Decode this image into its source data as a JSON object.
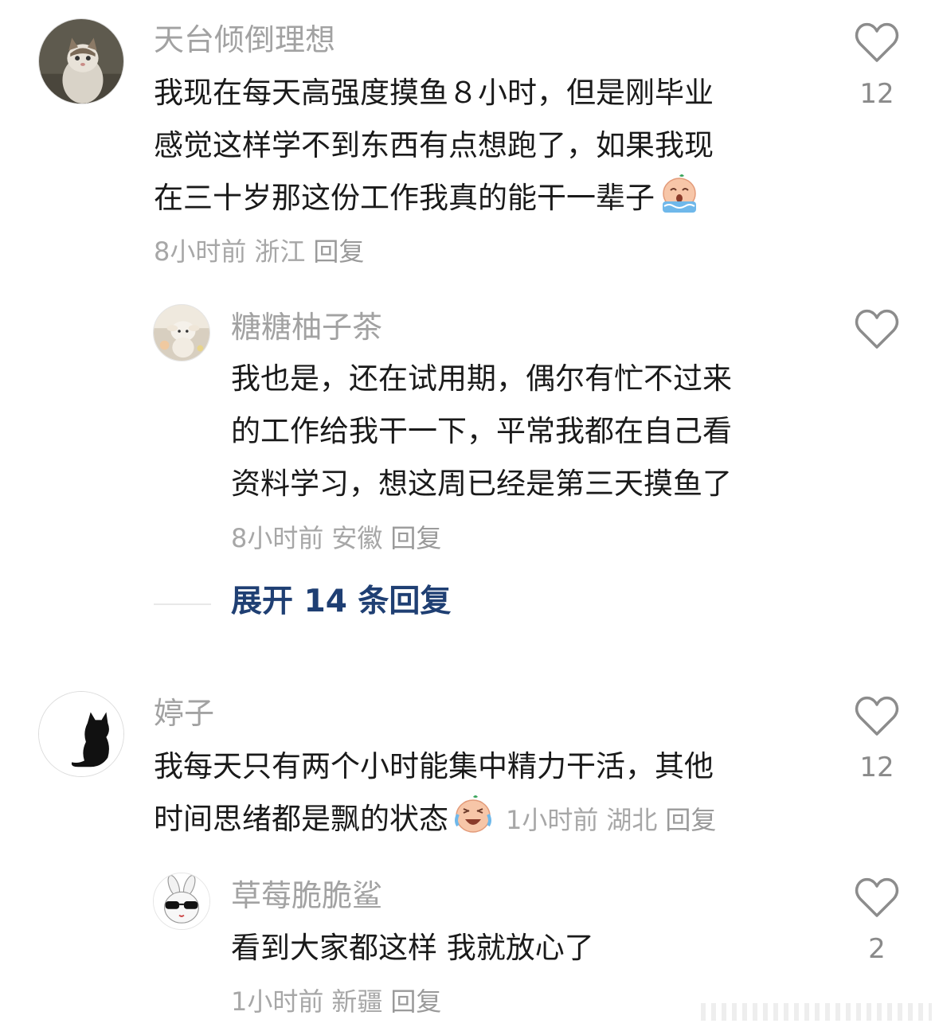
{
  "comments": [
    {
      "username": "天台倾倒理想",
      "lines": [
        "我现在每天高强度摸鱼８小时，但是刚毕业",
        "感觉这样学不到东西有点想跑了，如果我现",
        "在三十岁那这份工作我真的能干一辈子"
      ],
      "emoji": "crying-emoji",
      "time": "8小时前",
      "location": "浙江",
      "reply_label": "回复",
      "likes": "12",
      "avatar_icon": "cat-photo-avatar"
    },
    {
      "username": "糖糖柚子茶",
      "lines": [
        "我也是，还在试用期，偶尔有忙不过来",
        "的工作给我干一下，平常我都在自己看",
        "资料学习，想这周已经是第三天摸鱼了"
      ],
      "time": "8小时前",
      "location": "安徽",
      "reply_label": "回复",
      "likes": "",
      "avatar_icon": "lamb-plush-avatar"
    },
    {
      "username": "婷子",
      "lines": [
        "我每天只有两个小时能集中精力干活，其他",
        "时间思绪都是飘的状态"
      ],
      "emoji": "crying-laughing-emoji",
      "time": "1小时前",
      "location": "湖北",
      "reply_label": "回复",
      "likes": "12",
      "avatar_icon": "black-cat-silhouette-avatar"
    },
    {
      "username": "草莓脆脆鲨",
      "lines": [
        "看到大家都这样 我就放心了"
      ],
      "time": "1小时前",
      "location": "新疆",
      "reply_label": "回复",
      "likes": "2",
      "avatar_icon": "sunglasses-bunny-avatar"
    }
  ],
  "expand_replies": "展开 14 条回复",
  "colors": {
    "username": "#a2a2a2",
    "body_text": "#1a1a1a",
    "meta": "#a7a7a7",
    "expand_link": "#1f3f73",
    "heart_outline": "#8c8c8c"
  },
  "icons": {
    "like": "heart-outline-icon"
  }
}
